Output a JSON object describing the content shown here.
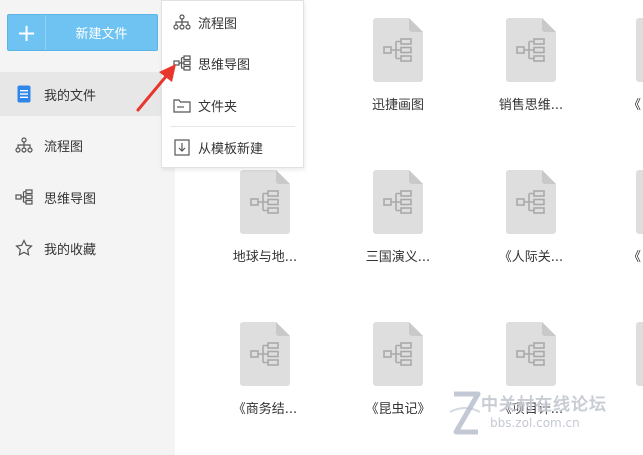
{
  "sidebar": {
    "new_button": {
      "icon": "+",
      "label": "新建文件"
    },
    "items": [
      {
        "icon": "document-icon",
        "label": "我的文件",
        "active": true
      },
      {
        "icon": "flowchart-icon",
        "label": "流程图"
      },
      {
        "icon": "mindmap-icon",
        "label": "思维导图"
      },
      {
        "icon": "star-icon",
        "label": "我的收藏"
      }
    ]
  },
  "new_menu": {
    "items": [
      {
        "icon": "flowchart-icon",
        "label": "流程图"
      },
      {
        "icon": "mindmap-icon",
        "label": "思维导图"
      },
      {
        "icon": "folder-icon",
        "label": "文件夹"
      },
      {
        "icon": "template-icon",
        "label": "从模板新建"
      }
    ]
  },
  "files": [
    {
      "name": "迅捷画图"
    },
    {
      "name": "销售思维..."
    },
    {
      "name": "地球与地..."
    },
    {
      "name": "三国演义..."
    },
    {
      "name": "《人际关..."
    },
    {
      "name": "《商务结..."
    },
    {
      "name": "《昆虫记》"
    },
    {
      "name": "《项目计..."
    }
  ],
  "edge_labels": [
    "《",
    "《"
  ],
  "watermark": {
    "title": "中关村在线论坛",
    "url": "bbs.zol.com.cn"
  },
  "colors": {
    "accent": "#6ec3f2",
    "active_icon": "#2f86e8",
    "arrow": "#e8362c",
    "doc_bg": "#dedede",
    "doc_icon": "#a9a9a9"
  }
}
